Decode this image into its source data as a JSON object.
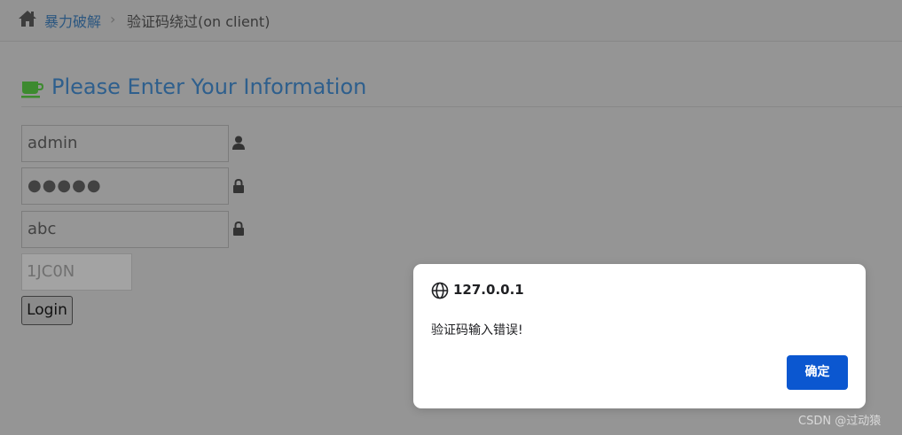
{
  "breadcrumb": {
    "home_icon": "home-icon",
    "link_label": "暴力破解",
    "separator": "›",
    "current_label": "验证码绕过(on client)"
  },
  "header": {
    "icon": "coffee-icon",
    "title": "Please Enter Your Information"
  },
  "form": {
    "username_value": "admin",
    "password_value": "●●●●●",
    "captcha_input_value": "abc",
    "captcha_code": "1JC0N",
    "login_label": "Login",
    "username_icon": "user-icon",
    "password_icon": "lock-icon",
    "captcha_icon": "lock-icon"
  },
  "alert_dialog": {
    "origin": "127.0.0.1",
    "message": "验证码输入错误!",
    "ok_label": "确定",
    "accent": "#0b57d0"
  },
  "watermark": "CSDN @过动猿"
}
